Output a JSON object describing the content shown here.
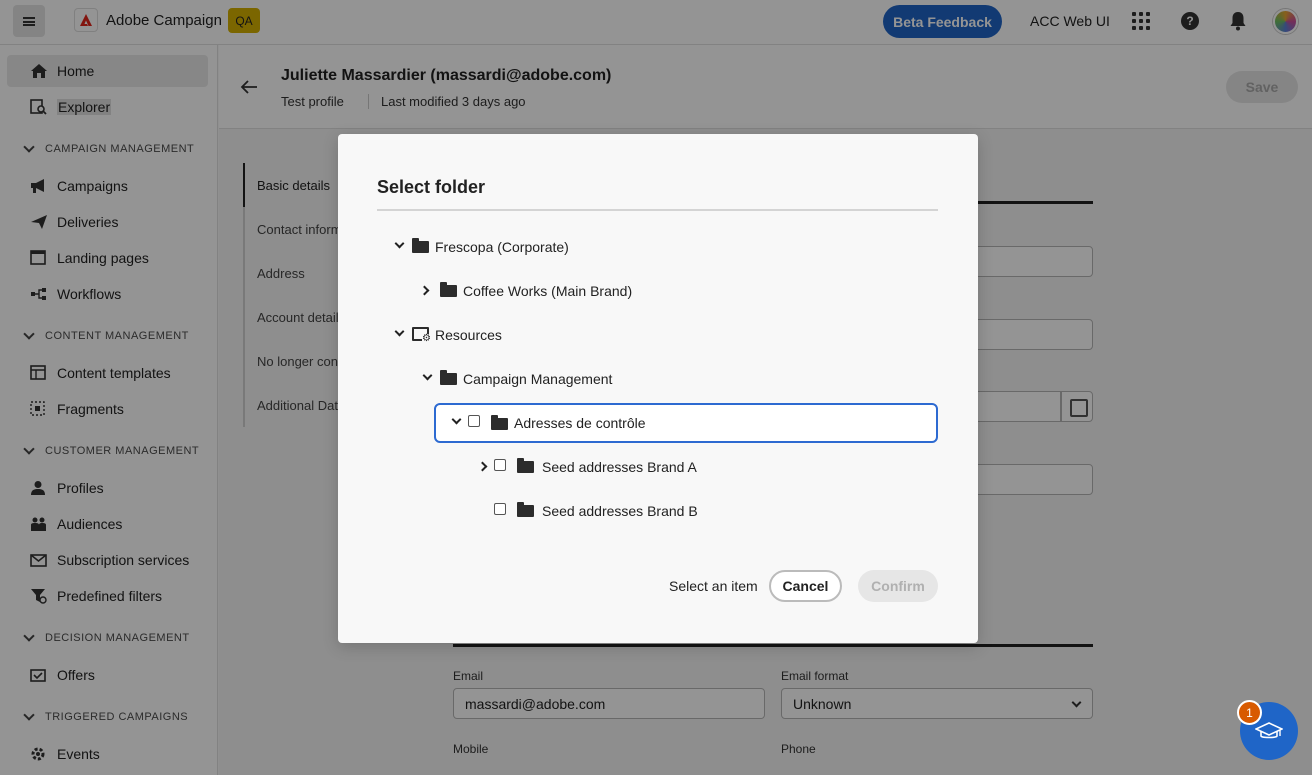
{
  "topbar": {
    "app_name": "Adobe Campaign",
    "env_badge": "QA",
    "beta_feedback": "Beta Feedback",
    "org_name": "ACC Web UI",
    "icons": [
      "menu-icon",
      "adobe-logo-icon",
      "apps-grid-icon",
      "help-icon",
      "bell-icon",
      "avatar"
    ]
  },
  "sidebar": {
    "home": "Home",
    "explorer": "Explorer",
    "sections": [
      {
        "title": "CAMPAIGN MANAGEMENT",
        "items": [
          "Campaigns",
          "Deliveries",
          "Landing pages",
          "Workflows"
        ]
      },
      {
        "title": "CONTENT MANAGEMENT",
        "items": [
          "Content templates",
          "Fragments"
        ]
      },
      {
        "title": "CUSTOMER MANAGEMENT",
        "items": [
          "Profiles",
          "Audiences",
          "Subscription services",
          "Predefined filters"
        ]
      },
      {
        "title": "DECISION MANAGEMENT",
        "items": [
          "Offers"
        ]
      },
      {
        "title": "TRIGGERED CAMPAIGNS",
        "items": [
          "Events"
        ]
      }
    ]
  },
  "header": {
    "title": "Juliette Massardier (massardi@adobe.com)",
    "subtitle": "Test profile",
    "modified": "Last modified 3 days ago",
    "save": "Save"
  },
  "tabs": [
    "Basic details",
    "Contact inform",
    "Address",
    "Account details",
    "No longer cont",
    "Additional Data"
  ],
  "form": {
    "email_label": "Email",
    "email_value": "massardi@adobe.com",
    "email_format_label": "Email format",
    "email_format_value": "Unknown",
    "mobile_label": "Mobile",
    "phone_label": "Phone"
  },
  "dialog": {
    "title": "Select folder",
    "tree": [
      {
        "label": "Frescopa (Corporate)",
        "expanded": true
      },
      {
        "label": "Coffee Works (Main Brand)",
        "expanded": false
      },
      {
        "label": "Resources",
        "expanded": true
      },
      {
        "label": "Campaign Management",
        "expanded": true
      },
      {
        "label": "Adresses de contrôle",
        "expanded": true,
        "checked": false
      },
      {
        "label": "Seed addresses Brand A",
        "expanded": false,
        "checked": false
      },
      {
        "label": "Seed addresses Brand B",
        "checked": false
      }
    ],
    "status": "Select an item",
    "cancel": "Cancel",
    "confirm": "Confirm"
  },
  "help_badge_count": "1",
  "colors": {
    "accent": "#1f65c7",
    "selected_border": "#2d6ad1",
    "badge": "#d85a00",
    "qa": "#d4b000"
  }
}
